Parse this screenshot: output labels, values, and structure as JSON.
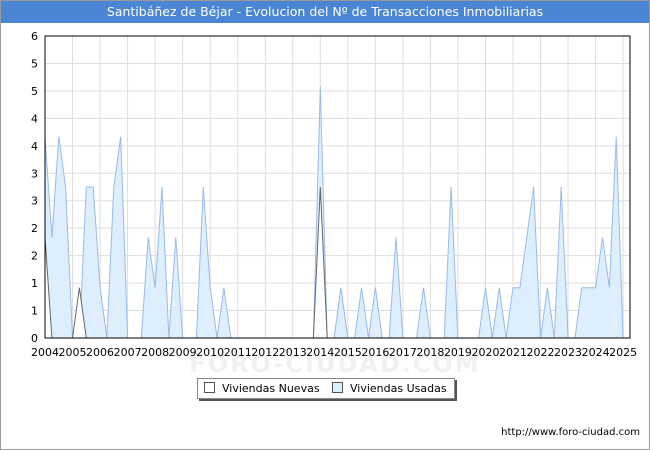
{
  "title": "Santibáñez de Béjar - Evolucion del Nº de Transacciones Inmobiliarias",
  "footer_url": "http://www.foro-ciudad.com",
  "watermark": "FORO-CIUDAD.COM",
  "colors": {
    "title_bg": "#4a86d4",
    "nuevas_fill": "#ffffff",
    "nuevas_line": "#666666",
    "usadas_fill": "#ddeefc",
    "usadas_line": "#99bbe8",
    "grid": "#dddddd"
  },
  "chart_data": {
    "type": "area",
    "title": "Santibáñez de Béjar - Evolucion del Nº de Transacciones Inmobiliarias",
    "xlabel": "",
    "ylabel": "",
    "ylim": [
      0,
      6
    ],
    "xlim": [
      2004,
      2025.25
    ],
    "grid": true,
    "legend_position": "bottom",
    "y_tick_labels": [
      "0",
      "1",
      "1",
      "2",
      "2",
      "3",
      "3",
      "4",
      "4",
      "5",
      "5",
      "6"
    ],
    "x_tick_labels": [
      "2004",
      "2005",
      "2006",
      "2007",
      "2008",
      "2009",
      "2010",
      "2011",
      "2012",
      "2013",
      "2014",
      "2015",
      "2016",
      "2017",
      "2018",
      "2019",
      "2020",
      "2021",
      "2022",
      "2023",
      "2024",
      "2025"
    ],
    "series": [
      {
        "name": "Viviendas Nuevas",
        "x": [
          2004,
          2004.25,
          2004.5,
          2004.75,
          2005,
          2005.25,
          2005.5,
          2005.75,
          2006,
          2013.75,
          2014,
          2014.25,
          2025.25
        ],
        "y": [
          2,
          0,
          0,
          0,
          0,
          1,
          0,
          0,
          0,
          0,
          3,
          0,
          0
        ]
      },
      {
        "name": "Viviendas Usadas",
        "x": [
          2004,
          2004.25,
          2004.5,
          2004.75,
          2005,
          2005.25,
          2005.5,
          2005.75,
          2006,
          2006.25,
          2006.5,
          2006.75,
          2007,
          2007.25,
          2007.5,
          2007.75,
          2008,
          2008.25,
          2008.5,
          2008.75,
          2009,
          2009.25,
          2009.5,
          2009.75,
          2010,
          2010.25,
          2010.5,
          2010.75,
          2011,
          2011.25,
          2011.5,
          2011.75,
          2012,
          2012.25,
          2012.5,
          2012.75,
          2013,
          2013.25,
          2013.5,
          2013.75,
          2014,
          2014.25,
          2014.5,
          2014.75,
          2015,
          2015.25,
          2015.5,
          2015.75,
          2016,
          2016.25,
          2016.5,
          2016.75,
          2017,
          2017.25,
          2017.5,
          2017.75,
          2018,
          2018.25,
          2018.5,
          2018.75,
          2019,
          2019.25,
          2019.5,
          2019.75,
          2020,
          2020.25,
          2020.5,
          2020.75,
          2021,
          2021.25,
          2021.5,
          2021.75,
          2022,
          2022.25,
          2022.5,
          2022.75,
          2023,
          2023.25,
          2023.5,
          2023.75,
          2024,
          2024.25,
          2024.5,
          2024.75,
          2025,
          2025.25
        ],
        "y": [
          4,
          2,
          4,
          3,
          0,
          0,
          3,
          3,
          1,
          0,
          3,
          4,
          0,
          0,
          0,
          2,
          1,
          3,
          0,
          2,
          0,
          0,
          0,
          3,
          1,
          0,
          1,
          0,
          0,
          0,
          0,
          0,
          0,
          0,
          0,
          0,
          0,
          0,
          0,
          0,
          5,
          0,
          0,
          1,
          0,
          0,
          1,
          0,
          1,
          0,
          0,
          2,
          0,
          0,
          0,
          1,
          0,
          0,
          0,
          3,
          0,
          0,
          0,
          0,
          1,
          0,
          1,
          0,
          1,
          1,
          2,
          3,
          0,
          1,
          0,
          3,
          0,
          0,
          1,
          1,
          1,
          2,
          1,
          4,
          0,
          0
        ]
      }
    ]
  }
}
